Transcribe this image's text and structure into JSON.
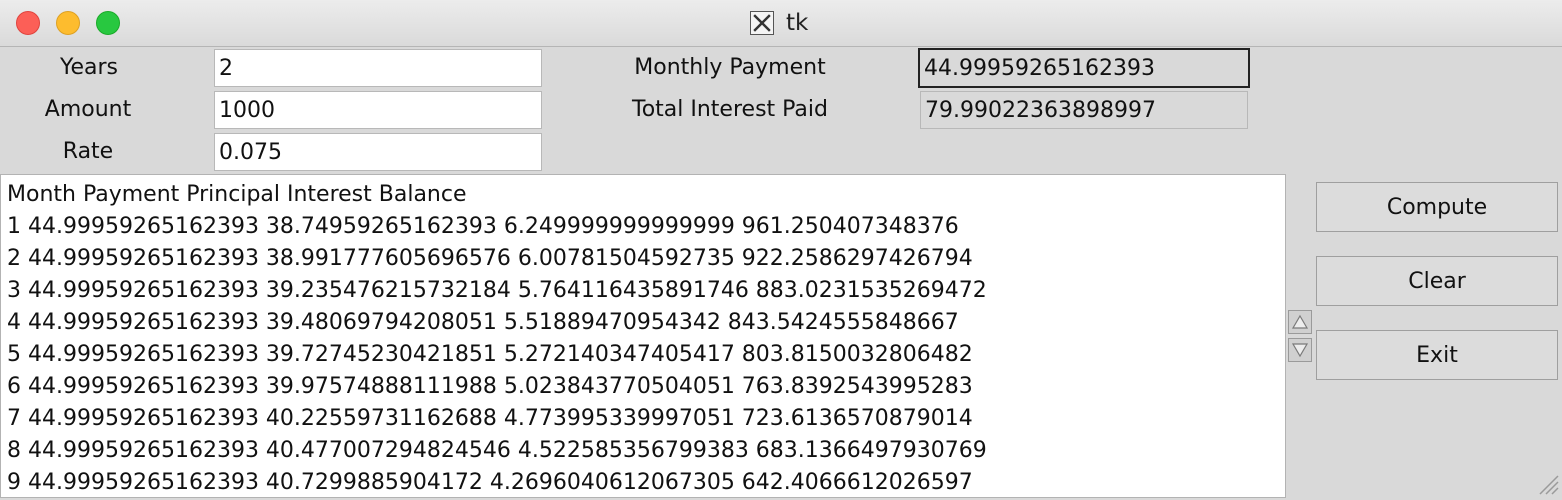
{
  "window": {
    "title": "tk"
  },
  "form": {
    "years_label": "Years",
    "amount_label": "Amount",
    "rate_label": "Rate",
    "years_value": "2",
    "amount_value": "1000",
    "rate_value": "0.075",
    "monthly_payment_label": "Monthly Payment",
    "total_interest_label": "Total Interest Paid",
    "monthly_payment_value": "44.99959265162393",
    "total_interest_value": "79.99022363898997"
  },
  "schedule": {
    "header": "Month Payment Principal Interest Balance",
    "rows": [
      "1 44.99959265162393 38.74959265162393 6.249999999999999 961.250407348376",
      "2 44.99959265162393 38.991777605696576 6.00781504592735 922.2586297426794",
      "3 44.99959265162393 39.235476215732184 5.764116435891746 883.0231535269472",
      "4 44.99959265162393 39.48069794208051 5.51889470954342 843.5424555848667",
      "5 44.99959265162393 39.72745230421851 5.272140347405417 803.8150032806482",
      "6 44.99959265162393 39.97574888111988 5.023843770504051 763.8392543995283",
      "7 44.99959265162393 40.22559731162688 4.773995339997051 723.6136570879014",
      "8 44.99959265162393 40.477007294824546 4.522585356799383 683.1366497930769",
      "9 44.99959265162393 40.7299885904172 4.2696040612067305 642.4066612026597"
    ]
  },
  "buttons": {
    "compute": "Compute",
    "clear": "Clear",
    "exit": "Exit"
  },
  "icons": {
    "close": "close-icon",
    "minimize": "minimize-icon",
    "maximize": "maximize-icon",
    "app": "x11-icon",
    "scroll_up": "scroll-up-icon",
    "scroll_down": "scroll-down-icon",
    "resize": "resize-grip-icon"
  },
  "colors": {
    "close": "#fc5f57",
    "minimize": "#fdbc2e",
    "maximize": "#28c840",
    "window_bg": "#d9d9d9"
  }
}
